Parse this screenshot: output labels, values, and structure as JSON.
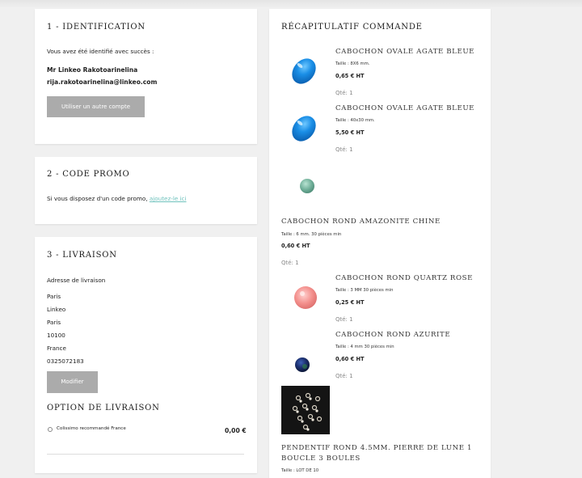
{
  "identification": {
    "title": "1 - IDENTIFICATION",
    "success_text": "Vous avez été identifié avec succès :",
    "user_name": "Mr Linkeo Rakotoarinelina",
    "user_email": "rija.rakotoarinelina@linkeo.com",
    "other_account_button": "Utiliser un autre compte"
  },
  "promo": {
    "title": "2 - CODE PROMO",
    "text": "Si vous disposez d'un code promo,",
    "link": "ajoutez-le ici"
  },
  "delivery": {
    "title": "3 - LIVRAISON",
    "address_label": "Adresse de livraison",
    "address_lines": [
      "Paris",
      "Linkeo",
      "Paris",
      "10100",
      "France",
      "0325072183"
    ],
    "modify_button": "Modifier",
    "option_title": "OPTION DE LIVRAISON",
    "option_label": "Colissimo recommandé France",
    "option_price": "0,00 €"
  },
  "summary": {
    "title": "RÉCAPITULATIF COMMANDE",
    "items": [
      {
        "name": "CABOCHON OVALE AGATE BLEUE",
        "size": "Taille : 8X6 mm.",
        "price": "0,65 € HT",
        "qty": "Qté: 1"
      },
      {
        "name": "CABOCHON OVALE AGATE BLEUE",
        "size": "Taille : 40x30 mm.",
        "price": "5,50 € HT",
        "qty": "Qté: 1"
      },
      {
        "name": "CABOCHON ROND AMAZONITE CHINE",
        "size": "Taille : 6 mm. 30 pièces min",
        "price": "0,60 € HT",
        "qty": "Qté: 1"
      },
      {
        "name": "CABOCHON ROND QUARTZ ROSE",
        "size": "Taille : 3 MM 30 pièces min",
        "price": "0,25 € HT",
        "qty": "Qté: 1"
      },
      {
        "name": "CABOCHON ROND AZURITE",
        "size": "Taille : 4 mm 30 pièces min",
        "price": "0,60 € HT",
        "qty": "Qté: 1"
      },
      {
        "name_line1": "PENDENTIF ROND 4.5MM. PIERRE DE LUNE 1",
        "name_line2": "BOUCLE 3 BOULES",
        "size": "Taille : LOT DE 10"
      }
    ]
  },
  "colors": {
    "accent_link": "#6fc2bd",
    "button_gray": "#ababab",
    "page_bg": "#f0f0f0"
  }
}
